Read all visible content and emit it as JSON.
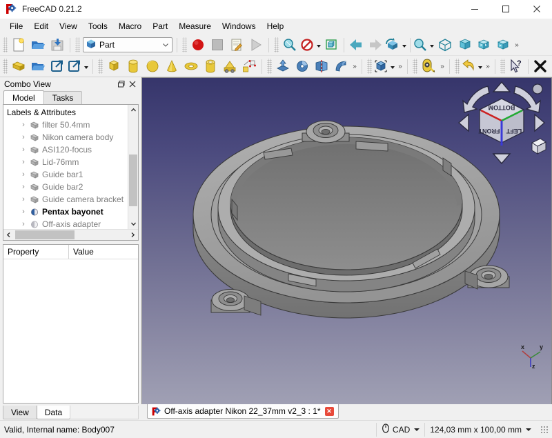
{
  "window": {
    "title": "FreeCAD 0.21.2",
    "logo_icon": "freecad-logo-icon",
    "minimize_label": "–",
    "maximize_label": "□",
    "close_label": "✕"
  },
  "menubar": {
    "items": [
      {
        "label": "File"
      },
      {
        "label": "Edit"
      },
      {
        "label": "View"
      },
      {
        "label": "Tools"
      },
      {
        "label": "Macro"
      },
      {
        "label": "Part"
      },
      {
        "label": "Measure"
      },
      {
        "label": "Windows"
      },
      {
        "label": "Help"
      }
    ]
  },
  "toolbars": {
    "row1": {
      "file": [
        {
          "name": "new-document-button",
          "icon": "new-file-icon"
        },
        {
          "name": "open-document-button",
          "icon": "open-folder-icon"
        },
        {
          "name": "save-document-button",
          "icon": "save-disk-icon"
        }
      ],
      "workbench": {
        "name": "workbench-selector",
        "value": "Part",
        "icon": "part-cube-icon",
        "arrow": "chevron-down-icon"
      },
      "macro": [
        {
          "name": "macro-record-button",
          "icon": "record-circle-icon"
        },
        {
          "name": "macro-stop-button",
          "icon": "stop-square-icon"
        },
        {
          "name": "macro-edit-button",
          "icon": "edit-macro-icon"
        },
        {
          "name": "macro-execute-button",
          "icon": "play-triangle-icon"
        }
      ],
      "view": [
        {
          "name": "fit-all-button",
          "icon": "fit-all-magnifier-icon"
        },
        {
          "name": "draw-style-button",
          "icon": "draw-style-no-icon",
          "has_caret": true
        },
        {
          "name": "bounding-box-button",
          "icon": "bounding-box-icon"
        },
        {
          "name": "previous-view-button",
          "icon": "arrow-left-icon"
        },
        {
          "name": "next-view-button",
          "icon": "arrow-right-icon"
        },
        {
          "name": "std-views-button",
          "icon": "std-views-cube-icon",
          "has_caret": true
        },
        {
          "name": "zoom-box-button",
          "icon": "zoom-box-icon",
          "has_caret": true
        },
        {
          "name": "axonometric-view-button",
          "icon": "axonometric-icon"
        },
        {
          "name": "front-view-button",
          "icon": "front-view-cube-icon"
        },
        {
          "name": "top-view-button",
          "icon": "top-view-cube-icon"
        },
        {
          "name": "right-view-button",
          "icon": "right-view-cube-icon"
        }
      ],
      "overflow_label": "»"
    },
    "row2": {
      "structure": [
        {
          "name": "create-part-button",
          "icon": "part-yellow-icon"
        },
        {
          "name": "create-group-button",
          "icon": "group-folder-icon"
        },
        {
          "name": "link-object-button",
          "icon": "make-link-icon"
        },
        {
          "name": "link-actions-button",
          "icon": "link-actions-icon",
          "has_caret": true
        }
      ],
      "primitives": [
        {
          "name": "box-button",
          "icon": "box-cube-icon"
        },
        {
          "name": "cylinder-button",
          "icon": "cylinder-icon"
        },
        {
          "name": "sphere-button",
          "icon": "sphere-icon"
        },
        {
          "name": "cone-button",
          "icon": "cone-icon"
        },
        {
          "name": "torus-button",
          "icon": "torus-icon"
        },
        {
          "name": "tube-button",
          "icon": "tube-icon"
        },
        {
          "name": "primitives-button",
          "icon": "primitives-icon"
        },
        {
          "name": "shape-builder-button",
          "icon": "shape-builder-icon"
        }
      ],
      "boolean": [
        {
          "name": "extrude-button",
          "icon": "extrude-icon"
        },
        {
          "name": "revolve-button",
          "icon": "revolve-icon"
        },
        {
          "name": "mirror-button",
          "icon": "mirror-icon"
        },
        {
          "name": "fillet-button",
          "icon": "sweep-surface-icon"
        }
      ],
      "view_section": [
        {
          "name": "section-cut-button",
          "icon": "section-box-icon",
          "has_caret": true
        }
      ],
      "measure": [
        {
          "name": "measure-button",
          "icon": "measure-tape-icon"
        }
      ],
      "undo": [
        {
          "name": "undo-button",
          "icon": "undo-arrow-icon",
          "has_caret": true
        }
      ],
      "help": [
        {
          "name": "whats-this-button",
          "icon": "whats-this-cursor-icon"
        },
        {
          "name": "close-document-button",
          "icon": "close-x-icon"
        }
      ],
      "overflow_label": "»"
    }
  },
  "combo_view": {
    "title": "Combo View",
    "float_icon": "float-window-icon",
    "close_icon": "close-icon",
    "tabs": [
      {
        "label": "Model",
        "active": true
      },
      {
        "label": "Tasks",
        "active": false
      }
    ],
    "tree": {
      "root_label": "Labels & Attributes",
      "items": [
        {
          "label": "filter 50.4mm",
          "icon": "body-icon",
          "visible": false
        },
        {
          "label": "Nikon camera body",
          "icon": "body-icon",
          "visible": false
        },
        {
          "label": "ASI120-focus",
          "icon": "body-icon",
          "visible": false
        },
        {
          "label": "Lid-76mm",
          "icon": "body-icon",
          "visible": false
        },
        {
          "label": "Guide bar1",
          "icon": "body-icon",
          "visible": false
        },
        {
          "label": "Guide bar2",
          "icon": "body-icon",
          "visible": false
        },
        {
          "label": "Guide camera bracket",
          "icon": "body-icon",
          "visible": false
        },
        {
          "label": "Pentax bayonet",
          "icon": "shape-icon",
          "visible": true
        },
        {
          "label": "Off-axis adapter",
          "icon": "shape-icon",
          "visible": false
        }
      ],
      "expander_glyph": "›",
      "scroll_up_glyph": "⌃",
      "scroll_down_glyph": "⌄",
      "scroll_left_glyph": "‹",
      "scroll_right_glyph": "›"
    },
    "property_editor": {
      "columns": [
        "Property",
        "Value"
      ],
      "rows": []
    },
    "bottom_tabs": [
      {
        "label": "View",
        "active": false
      },
      {
        "label": "Data",
        "active": true
      }
    ]
  },
  "view3d": {
    "background_top": "#36356b",
    "background_bottom": "#a0a0b4",
    "model_color": "#9a9a9a",
    "model_name": "off-axis-adapter-ring",
    "navigation_cube": {
      "name": "navigation-cube",
      "faces": {
        "top": "BOTTOM",
        "left": "FRONT",
        "right": "LEFT"
      },
      "arrow_up": "nav-arrow-up-icon",
      "arrow_down": "nav-arrow-down-icon",
      "arrow_left": "nav-arrow-left-icon",
      "arrow_right": "nav-arrow-right-icon",
      "rotate_left": "nav-rotate-left-icon",
      "rotate_right": "nav-rotate-right-icon",
      "corner_dot": "nav-dot-icon",
      "home_cube": "nav-home-cube-icon"
    },
    "axis_cross": {
      "name": "axis-cross",
      "x_label": "x",
      "x_color": "#c04040",
      "y_label": "y",
      "y_color": "#3a8a3a",
      "z_label": "z",
      "z_color": "#3a3ac0"
    }
  },
  "document_tabs": [
    {
      "label": "Off-axis adapter Nikon 22_37mm v2_3 : 1*",
      "icon": "freecad-document-icon",
      "close_glyph": "✕",
      "active": true
    }
  ],
  "statusbar": {
    "message": "Valid, Internal name: Body007",
    "nav_style": {
      "label": "CAD",
      "icon": "nav-style-icon"
    },
    "dimensions": "124,03 mm x 100,00 mm"
  }
}
